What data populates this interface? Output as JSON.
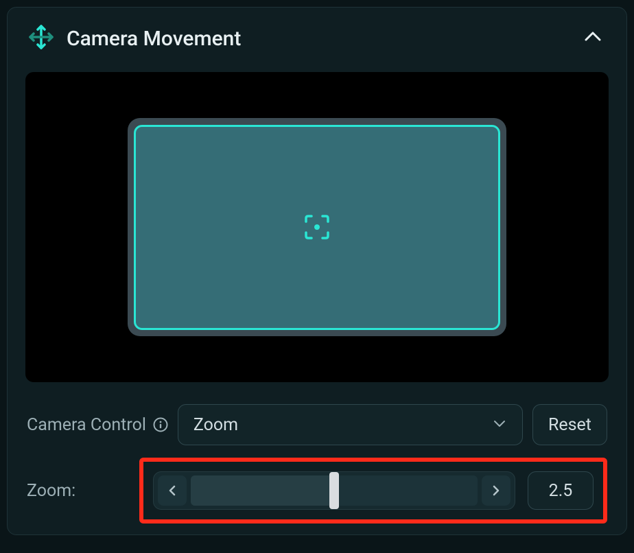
{
  "panel": {
    "title": "Camera Movement",
    "accent_color": "#2ae6d4"
  },
  "camera_control": {
    "label": "Camera Control",
    "selected": "Zoom",
    "reset_label": "Reset"
  },
  "zoom": {
    "label": "Zoom:",
    "value": "2.5",
    "slider_percent": 50
  }
}
